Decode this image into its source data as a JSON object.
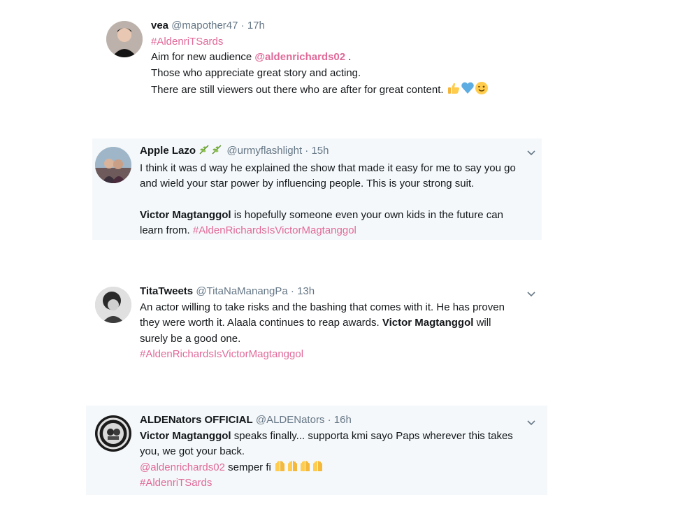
{
  "tweets": [
    {
      "name": "vea",
      "handle": "@mapother47",
      "separator": "·",
      "time": "17h",
      "hashtag_top": "#AldenriTSards",
      "line1_text": "Aim for new audience ",
      "line1_mention": "@aldenrichards02",
      "line1_end": " .",
      "line2": "Those who appreciate great story and acting.",
      "line3": "There are still viewers out there who are after for great content.",
      "emojis": [
        "thumbs-up",
        "blue-heart",
        "winking-face"
      ]
    },
    {
      "name": "Apple Lazo",
      "name_badges": [
        "herb-icon",
        "herb-icon"
      ],
      "handle": "@urmyflashlight",
      "separator": "·",
      "time": "15h",
      "line1": "I think it was d way he explained the show that made it easy for me to say you go",
      "line2": "and wield your star power by influencing people. This is your strong suit.",
      "line3_bold": "Victor Magtanggol",
      "line3_rest": " is hopefully someone even your own kids in the future can",
      "line4_text": "learn from. ",
      "line4_tag": "#AldenRichardsIsVictorMagtanggol"
    },
    {
      "name": "TitaTweets",
      "handle": "@TitaNaManangPa",
      "separator": "·",
      "time": "13h",
      "line1": "An actor willing to take risks and the bashing that comes with it. He has proven",
      "line2_text": "they were worth it. Alaala continues to reap awards. ",
      "line2_bold": "Victor Magtanggol",
      "line2_end": " will",
      "line3": "surely be a good one.",
      "line4_tag": "#AldenRichardsIsVictorMagtanggol"
    },
    {
      "name": "ALDENators OFFICIAL",
      "handle": "@ALDENators",
      "separator": "·",
      "time": "16h",
      "line1_bold": "Victor Magtanggol",
      "line1_rest": " speaks finally... supporta kmi sayo Paps wherever this takes",
      "line2": "you, we got your back.",
      "line3_mention": "@aldenrichards02",
      "line3_rest": " semper fi ",
      "line3_emojis": [
        "raising-hands",
        "raising-hands",
        "raising-hands",
        "raising-hands"
      ],
      "line4_tag": "#AldenriTSards"
    }
  ],
  "colors": {
    "hashtag": "#e06a99",
    "card_background": "#f5f8fa",
    "secondary_text": "#657786"
  }
}
